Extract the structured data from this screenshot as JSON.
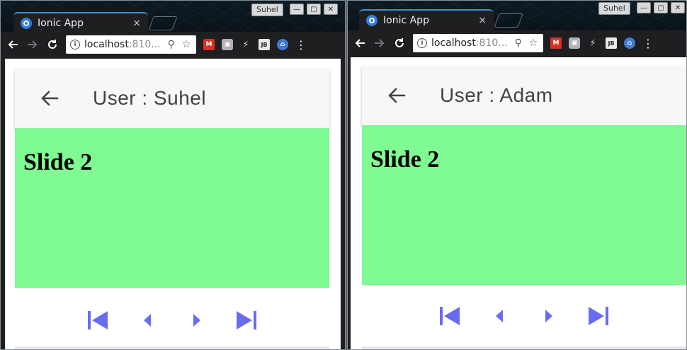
{
  "windows": [
    {
      "tab_title": "Ionic App",
      "tab_close": "×",
      "os_user": "Suhel",
      "address_host": "localhost",
      "address_rest": ":810...",
      "header_title": "User : Suhel",
      "slide_heading": "Slide 2",
      "slide_color": "#80fa92"
    },
    {
      "tab_title": "Ionic App",
      "tab_close": "×",
      "os_user": "Suhel",
      "address_host": "localhost",
      "address_rest": ":810...",
      "header_title": "User : Adam",
      "slide_heading": "Slide 2",
      "slide_color": "#80fa92"
    }
  ],
  "extension_icons": [
    "gmail-icon",
    "camera-icon",
    "bolt-icon",
    "jb-icon",
    "bank-icon"
  ],
  "extension_labels": {
    "jb": "JB"
  },
  "control_icons": [
    "skip-first-icon",
    "previous-icon",
    "next-icon",
    "skip-last-icon"
  ],
  "colors": {
    "accent_controls": "#6a6cf0",
    "tab_highlight": "#3d8fd6",
    "header_bg": "#f7f7f7"
  }
}
